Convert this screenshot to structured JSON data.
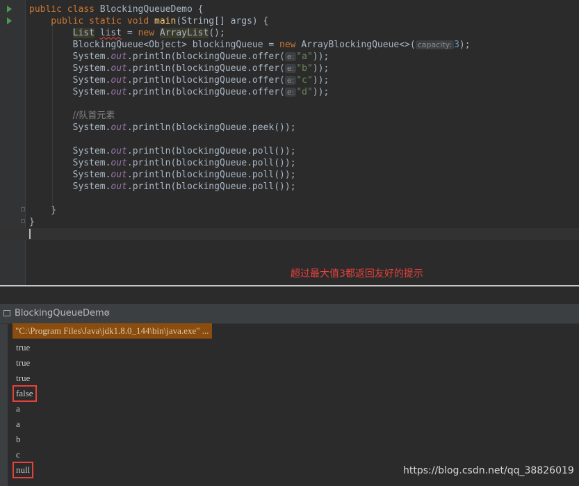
{
  "editor": {
    "lines": [
      [
        [
          "kw",
          "public "
        ],
        [
          "kw",
          "class "
        ],
        [
          "type",
          "BlockingQueueDemo {"
        ]
      ],
      [
        [
          "kw",
          "    public static void "
        ],
        [
          "fn",
          "main"
        ],
        [
          "type",
          "(String[] args) {"
        ]
      ],
      [
        [
          "type",
          "        "
        ],
        [
          "hl",
          "List"
        ],
        [
          "type",
          " "
        ],
        [
          "ul",
          "list"
        ],
        [
          "type",
          " = "
        ],
        [
          "kw",
          "new "
        ],
        [
          "hl",
          "ArrayList"
        ],
        [
          "type",
          "();"
        ]
      ],
      [
        [
          "type",
          "        BlockingQueue<Object> blockingQueue = "
        ],
        [
          "kw",
          "new "
        ],
        [
          "type",
          "ArrayBlockingQueue<>("
        ],
        [
          "hint",
          "capacity:"
        ],
        [
          "num",
          "3"
        ],
        [
          "type",
          ");"
        ]
      ],
      [
        [
          "type",
          "        System."
        ],
        [
          "field",
          "out"
        ],
        [
          "type",
          ".println(blockingQueue.offer("
        ],
        [
          "hint",
          "e:"
        ],
        [
          "str",
          "\"a\""
        ],
        [
          "type",
          "));"
        ]
      ],
      [
        [
          "type",
          "        System."
        ],
        [
          "field",
          "out"
        ],
        [
          "type",
          ".println(blockingQueue.offer("
        ],
        [
          "hint",
          "e:"
        ],
        [
          "str",
          "\"b\""
        ],
        [
          "type",
          "));"
        ]
      ],
      [
        [
          "type",
          "        System."
        ],
        [
          "field",
          "out"
        ],
        [
          "type",
          ".println(blockingQueue.offer("
        ],
        [
          "hint",
          "e:"
        ],
        [
          "str",
          "\"c\""
        ],
        [
          "type",
          "));"
        ]
      ],
      [
        [
          "type",
          "        System."
        ],
        [
          "field",
          "out"
        ],
        [
          "type",
          ".println(blockingQueue.offer("
        ],
        [
          "hint",
          "e:"
        ],
        [
          "str",
          "\"d\""
        ],
        [
          "type",
          "));"
        ]
      ],
      [],
      [
        [
          "type",
          "        "
        ],
        [
          "cmt",
          "//队首元素"
        ]
      ],
      [
        [
          "type",
          "        System."
        ],
        [
          "field",
          "out"
        ],
        [
          "type",
          ".println(blockingQueue.peek());"
        ]
      ],
      [],
      [
        [
          "type",
          "        System."
        ],
        [
          "field",
          "out"
        ],
        [
          "type",
          ".println(blockingQueue.poll());"
        ]
      ],
      [
        [
          "type",
          "        System."
        ],
        [
          "field",
          "out"
        ],
        [
          "type",
          ".println(blockingQueue.poll());"
        ]
      ],
      [
        [
          "type",
          "        System."
        ],
        [
          "field",
          "out"
        ],
        [
          "type",
          ".println(blockingQueue.poll());"
        ]
      ],
      [
        [
          "type",
          "        System."
        ],
        [
          "field",
          "out"
        ],
        [
          "type",
          ".println(blockingQueue.poll());"
        ]
      ],
      [],
      [
        [
          "type",
          "    }"
        ]
      ],
      [
        [
          "type",
          "}"
        ]
      ]
    ],
    "annotation": "超过最大值3都返回友好的提示"
  },
  "run": {
    "tab_label": "BlockingQueueDemo",
    "close_glyph": "×",
    "command": "\"C:\\Program Files\\Java\\jdk1.8.0_144\\bin\\java.exe\" ...",
    "output": [
      "true",
      "true",
      "true",
      "false",
      "a",
      "a",
      "b",
      "c",
      "null"
    ],
    "highlighted": [
      3,
      8
    ]
  },
  "watermark": "https://blog.csdn.net/qq_38826019",
  "colors": {
    "highlight_box": "#e8413c",
    "command_bg": "#8a4d0f"
  }
}
